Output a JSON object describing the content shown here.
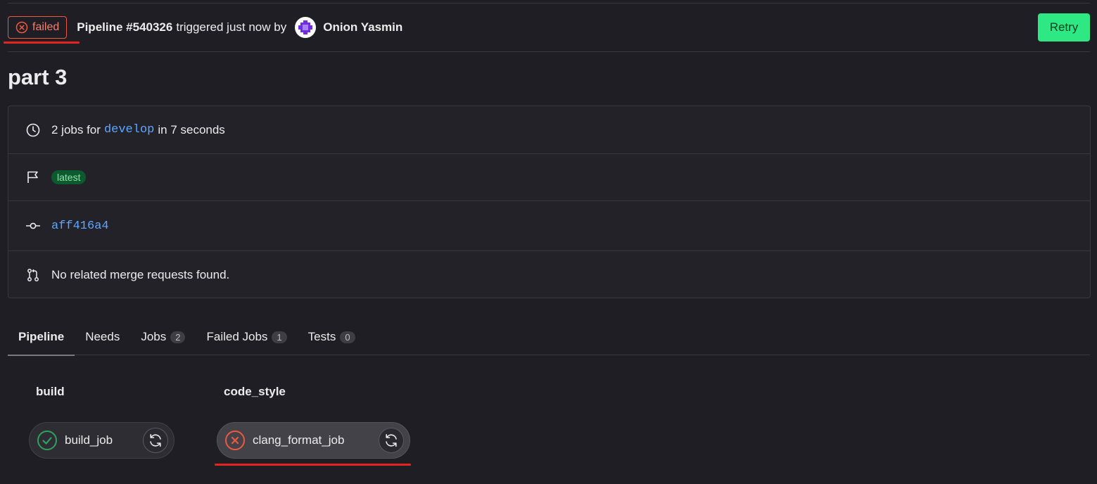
{
  "header": {
    "status": "failed",
    "pipeline_label": "Pipeline #540326",
    "triggered_text": "triggered just now by",
    "user_name": "Onion Yasmin",
    "retry_label": "Retry"
  },
  "title": "part 3",
  "info": {
    "jobs_prefix": "2 jobs for",
    "branch": "develop",
    "duration": "in 7 seconds",
    "badge": "latest",
    "commit": "aff416a4",
    "merge_requests": "No related merge requests found."
  },
  "tabs": [
    {
      "label": "Pipeline"
    },
    {
      "label": "Needs"
    },
    {
      "label": "Jobs",
      "count": "2"
    },
    {
      "label": "Failed Jobs",
      "count": "1"
    },
    {
      "label": "Tests",
      "count": "0"
    }
  ],
  "stages": [
    {
      "name": "build",
      "job": "build_job",
      "status": "passed"
    },
    {
      "name": "code_style",
      "job": "clang_format_job",
      "status": "failed"
    }
  ],
  "colors": {
    "failed": "#ec5941",
    "passed": "#2da160",
    "link": "#5ea6ff",
    "retry_button": "#2ee884",
    "highlight_underline": "#e2251f"
  }
}
